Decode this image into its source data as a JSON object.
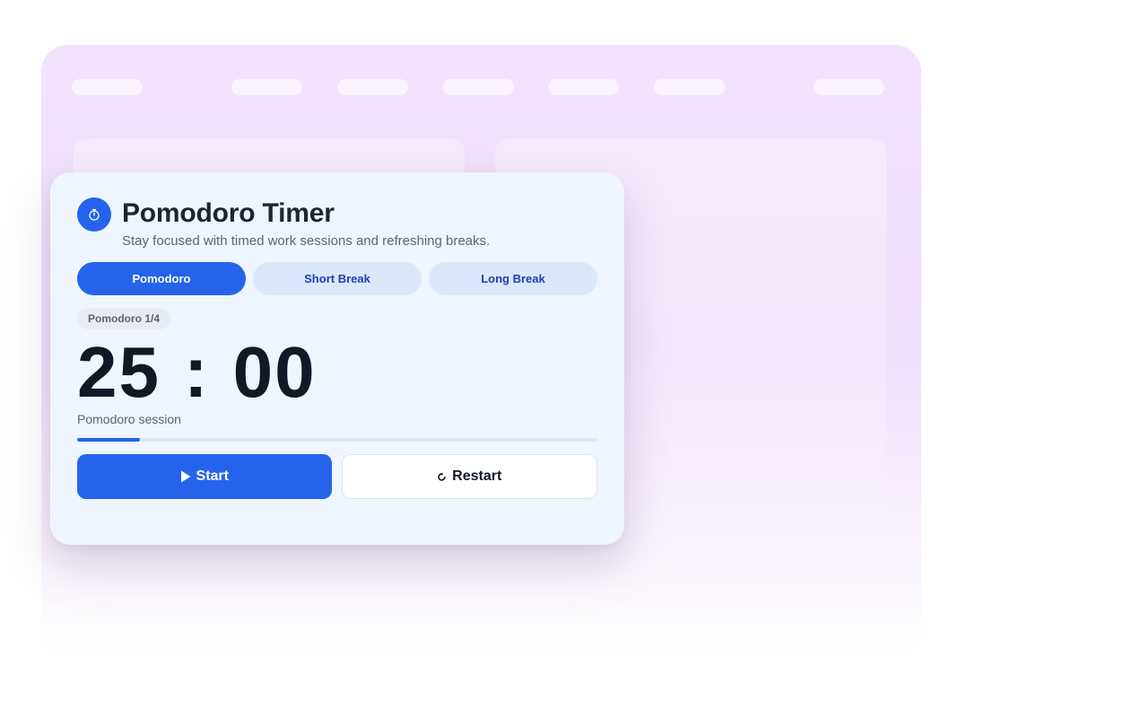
{
  "app": {
    "title": "Pomodoro Timer",
    "subtitle": "Stay focused with timed work sessions and refreshing breaks.",
    "icon": "stopwatch-icon"
  },
  "tabs": [
    {
      "label": "Pomodoro",
      "active": true
    },
    {
      "label": "Short Break",
      "active": false
    },
    {
      "label": "Long Break",
      "active": false
    }
  ],
  "session": {
    "badge": "Pomodoro 1/4",
    "minutes": "25",
    "separator": ":",
    "seconds": "00",
    "label": "Pomodoro session",
    "progress": 0.12
  },
  "controls": {
    "start_label": "Start",
    "start_icon": "play-icon",
    "restart_label": "Restart",
    "restart_icon": "restart-icon"
  },
  "colors": {
    "accent": "#2563eb",
    "card_background": "#eef5fe",
    "tab_inactive": "#dbe8fc",
    "text_primary": "#1c2536",
    "backdrop": "#f2e2fb"
  }
}
